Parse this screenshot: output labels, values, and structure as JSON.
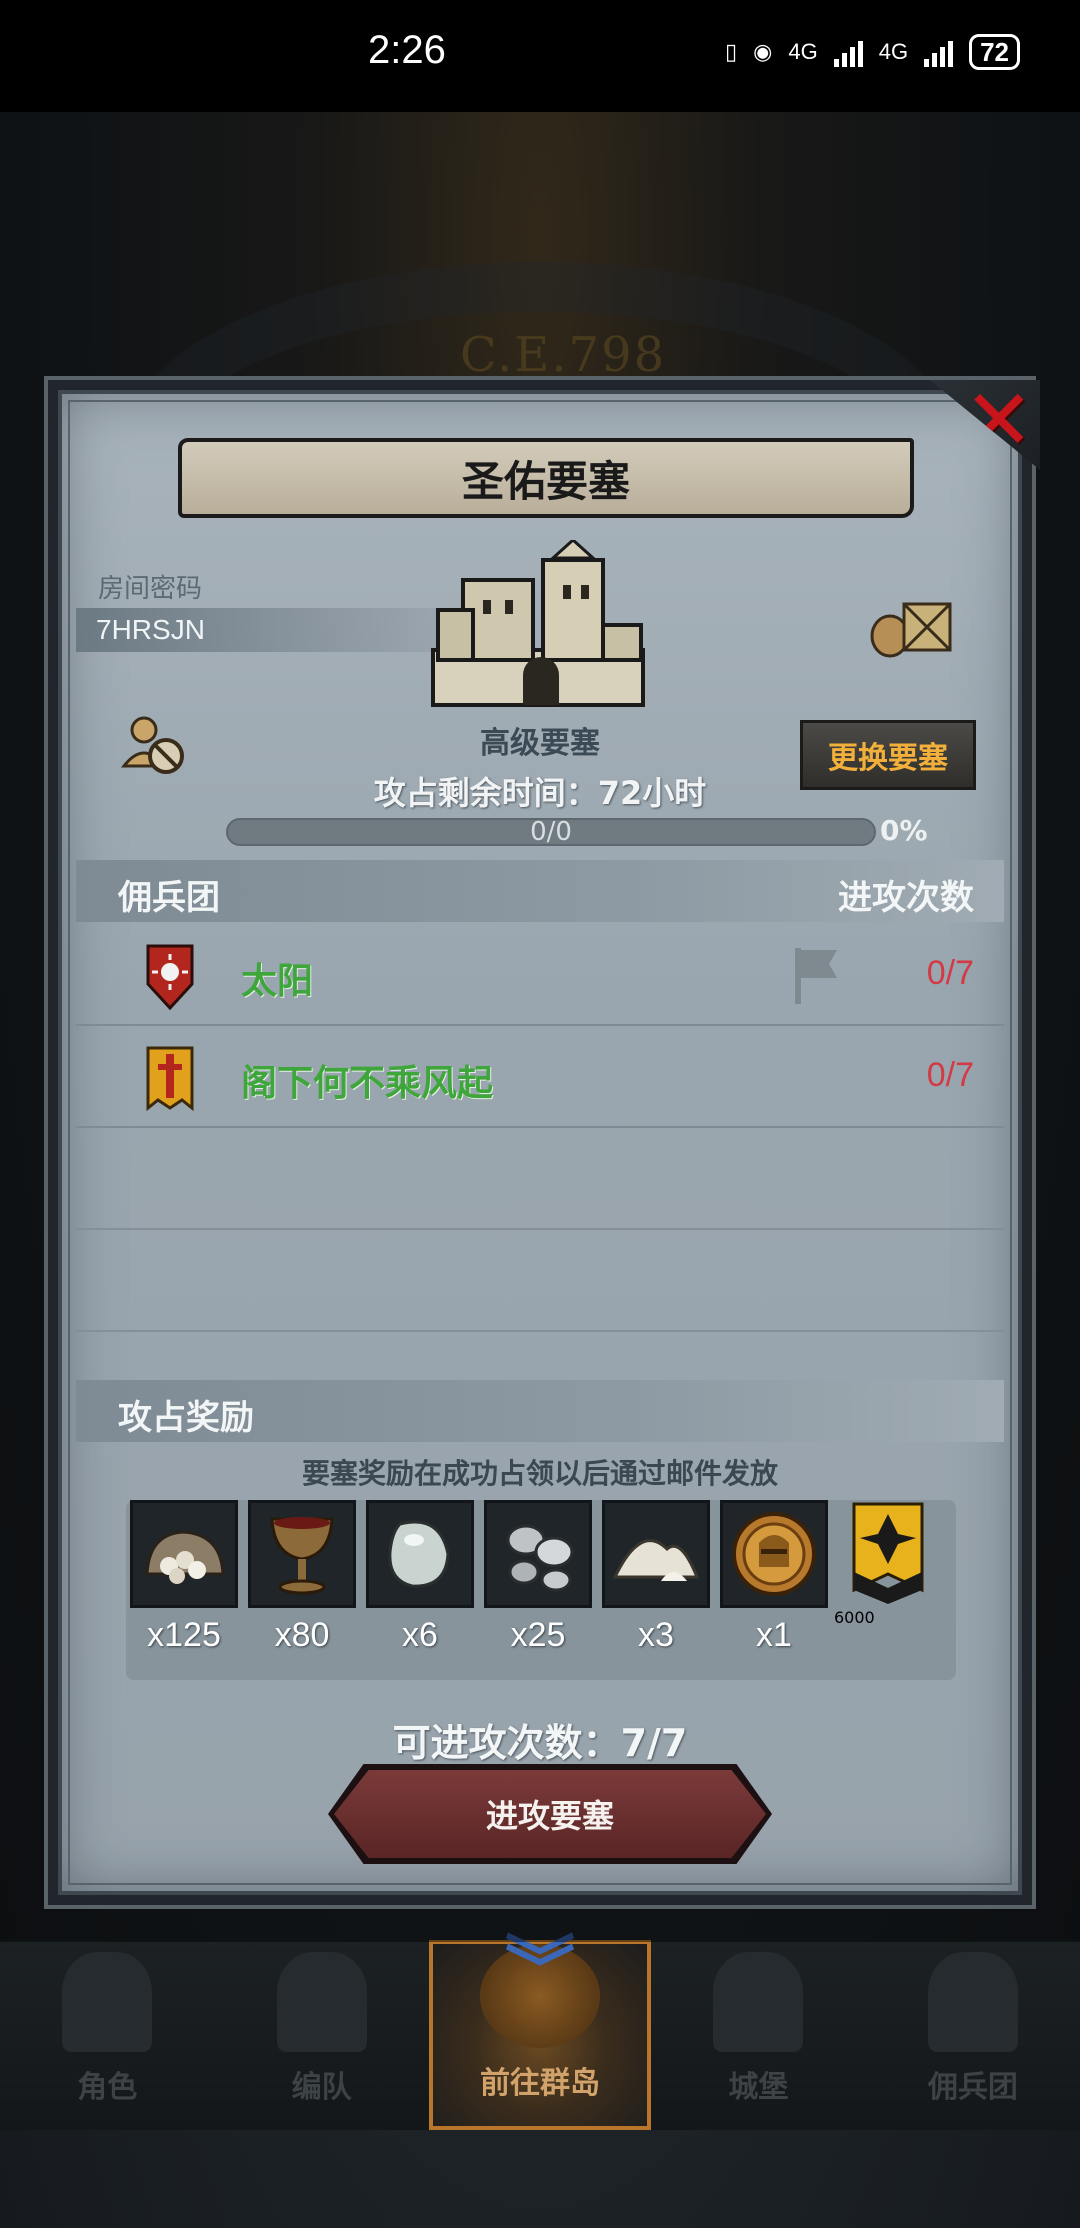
{
  "status_bar": {
    "time": "2:26",
    "battery": "72",
    "net1": "4G",
    "net2": "4G"
  },
  "background": {
    "year": "C.E.798"
  },
  "dialog": {
    "title": "圣佑要塞",
    "room_label": "房间密码",
    "room_code": "7HRSJN",
    "fortress_level": "高级要塞",
    "time_left": "攻占剩余时间：72小时",
    "progress_text": "0/0",
    "progress_percent": "0%",
    "progress_value": 0,
    "swap_button": "更换要塞",
    "merc_header": {
      "left": "佣兵团",
      "right": "进攻次数"
    },
    "mercs": [
      {
        "name": "太阳",
        "count": "0/7"
      },
      {
        "name": "阁下何不乘风起",
        "count": "0/7"
      }
    ],
    "reward_header": "攻占奖励",
    "reward_note": "要塞奖励在成功占领以后通过邮件发放",
    "rewards": [
      {
        "icon": "stone-sack-icon",
        "qty": "x125"
      },
      {
        "icon": "goblet-icon",
        "qty": "x80"
      },
      {
        "icon": "pearl-stone-icon",
        "qty": "x6"
      },
      {
        "icon": "silver-ore-icon",
        "qty": "x25"
      },
      {
        "icon": "salt-pile-icon",
        "qty": "x3"
      },
      {
        "icon": "knight-medal-icon",
        "qty": "x1"
      }
    ],
    "banner_reward": {
      "icon": "guild-banner-icon",
      "qty": "6000"
    },
    "attempts": "可进攻次数：7/7",
    "attack_button": "进攻要塞"
  },
  "bottom_nav": [
    {
      "label": "角色"
    },
    {
      "label": "编队"
    },
    {
      "label": "前往群岛",
      "active": true
    },
    {
      "label": "城堡"
    },
    {
      "label": "佣兵团"
    }
  ]
}
